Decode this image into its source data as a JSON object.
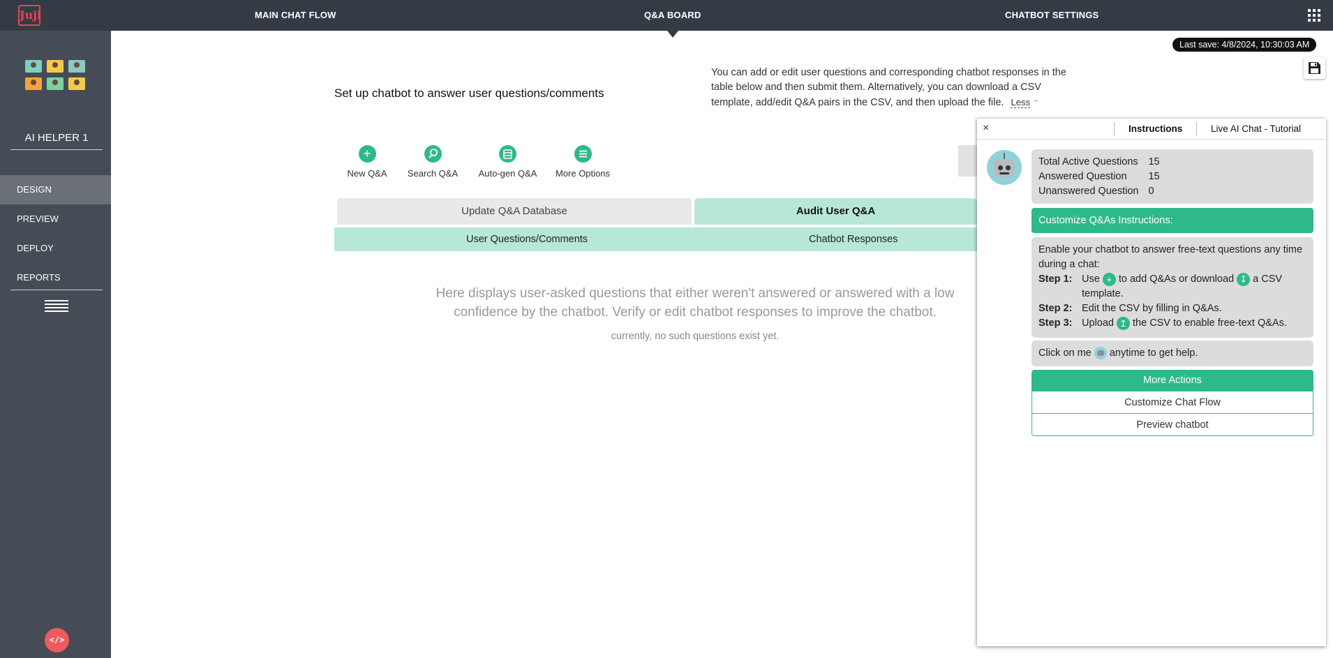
{
  "topbar": {
    "logo_text": "Juji",
    "nav": [
      {
        "label": "MAIN CHAT FLOW",
        "active": false
      },
      {
        "label": "Q&A BOARD",
        "active": true
      },
      {
        "label": "CHATBOT SETTINGS",
        "active": false
      }
    ],
    "apps_icon": "apps-grid-icon"
  },
  "sidebar": {
    "helper_name": "AI HELPER 1",
    "items": [
      {
        "label": "DESIGN",
        "active": true
      },
      {
        "label": "PREVIEW",
        "active": false
      },
      {
        "label": "DEPLOY",
        "active": false
      },
      {
        "label": "REPORTS",
        "active": false
      }
    ],
    "code_button": "</>"
  },
  "main": {
    "title": "Set up chatbot to answer user questions/comments",
    "description": "You can add or edit user questions and corresponding chatbot responses in the table below and then submit them. Alternatively, you can download a CSV template, add/edit Q&A pairs in the CSV, and then upload the file.",
    "less_label": "Less",
    "actions": [
      {
        "label": "New Q&A",
        "icon": "plus-icon"
      },
      {
        "label": "Search Q&A",
        "icon": "search-icon"
      },
      {
        "label": "Auto-gen Q&A",
        "icon": "stack-icon"
      },
      {
        "label": "More Options",
        "icon": "menu-icon"
      }
    ],
    "tabs": [
      {
        "label": "Update Q&A Database",
        "active": false
      },
      {
        "label": "Audit User Q&A",
        "active": true
      }
    ],
    "columns": [
      "User Questions/Comments",
      "Chatbot Responses"
    ],
    "empty_message": "Here displays user-asked questions that either weren't answered or answered with a low confidence by the chatbot. Verify or edit chatbot responses to improve the chatbot.",
    "empty_sub": "currently, no such questions exist yet.",
    "last_save": "Last save: 4/8/2024, 10:30:03 AM"
  },
  "panel": {
    "close": "×",
    "tabs": [
      "Instructions",
      "Live AI Chat - Tutorial"
    ],
    "stats": [
      {
        "label": "Total Active Questions",
        "value": "15"
      },
      {
        "label": "Answered Question",
        "value": "15"
      },
      {
        "label": "Unanswered Question",
        "value": "0"
      }
    ],
    "customize_title": "Customize Q&As Instructions:",
    "intro": "Enable your chatbot to answer free-text questions any time during a chat:",
    "steps": [
      {
        "label": "Step 1:",
        "pre": "Use",
        "mid": "to add Q&As or download",
        "post": "a CSV template."
      },
      {
        "label": "Step 2:",
        "text": "Edit the CSV by filling in Q&As."
      },
      {
        "label": "Step 3:",
        "pre": "Upload",
        "post": "the CSV to enable free-text Q&As."
      }
    ],
    "help_pre": "Click on me",
    "help_post": "anytime to get help.",
    "more_actions_title": "More Actions",
    "more_actions": [
      "Customize Chat Flow",
      "Preview chatbot"
    ]
  },
  "colors": {
    "accent": "#2db98a",
    "accent_light": "#b6e8d5",
    "topbar": "#353b45",
    "sidebar": "#454c55",
    "logo": "#e2474e"
  }
}
